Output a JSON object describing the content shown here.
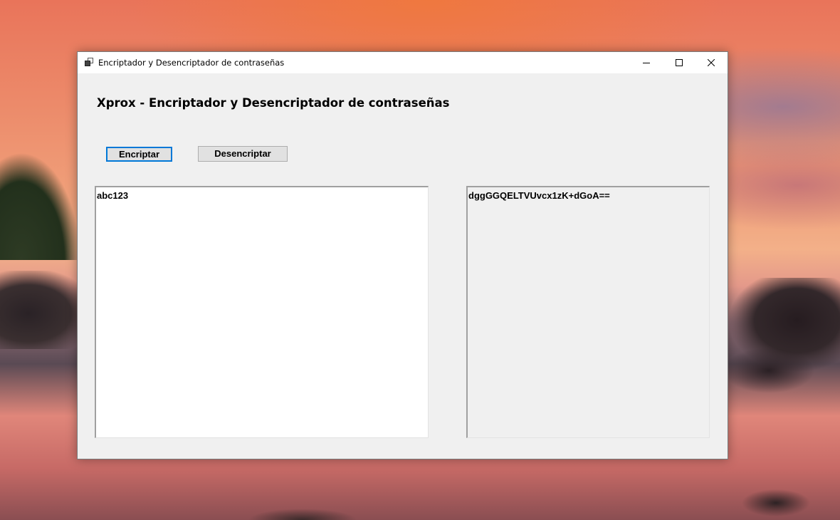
{
  "window": {
    "title": "Encriptador y Desencriptador de contraseñas",
    "controls": {
      "minimize_icon": "minimize-icon",
      "maximize_icon": "maximize-icon",
      "close_icon": "close-icon"
    }
  },
  "main": {
    "heading": "Xprox - Encriptador y Desencriptador de contraseñas",
    "buttons": {
      "encrypt_label": "Encriptar",
      "decrypt_label": "Desencriptar"
    },
    "input_text": "abc123",
    "output_text": "dggGGQELTVUvcx1zK+dGoA=="
  },
  "colors": {
    "window_background": "#f0f0f0",
    "titlebar_background": "#ffffff",
    "focus_accent": "#0078d7"
  }
}
